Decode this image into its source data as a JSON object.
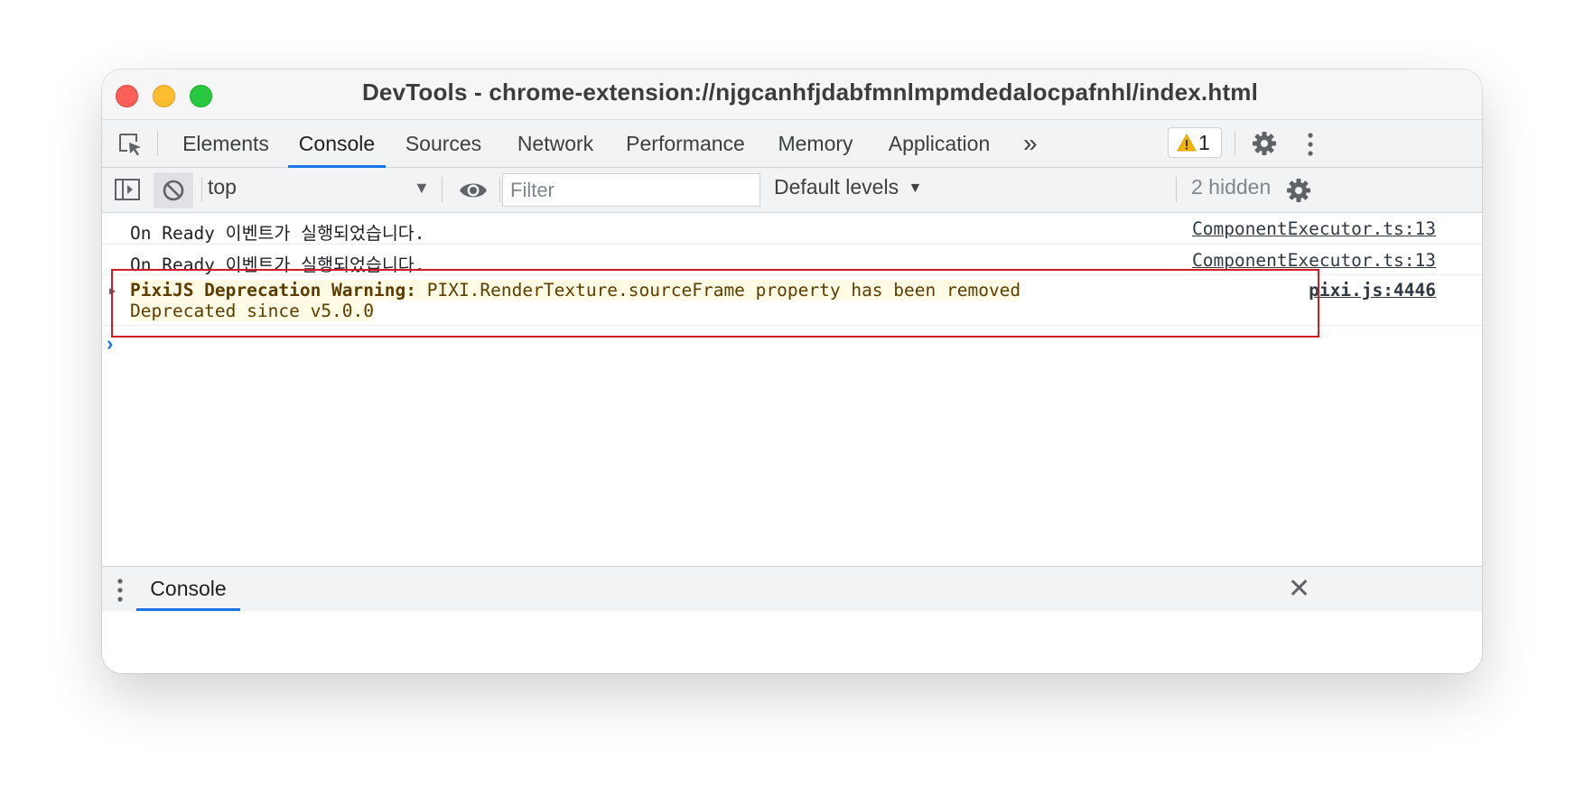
{
  "window": {
    "title": "DevTools - chrome-extension://njgcanhfjdabfmnlmpmdedalocpafnhl/index.html"
  },
  "tabs": [
    {
      "label": "Elements",
      "active": false
    },
    {
      "label": "Console",
      "active": true
    },
    {
      "label": "Sources",
      "active": false
    },
    {
      "label": "Network",
      "active": false
    },
    {
      "label": "Performance",
      "active": false
    },
    {
      "label": "Memory",
      "active": false
    },
    {
      "label": "Application",
      "active": false
    }
  ],
  "more_tabs_icon": "chevron-double-right-icon",
  "warning_badge": {
    "icon": "warning-triangle-icon",
    "count": "1"
  },
  "toolbar": {
    "context": "top",
    "filter_placeholder": "Filter",
    "levels": "Default levels",
    "levels_arrow": "▼",
    "context_arrow": "▼",
    "hidden_count": "2 hidden"
  },
  "console": {
    "messages": [
      {
        "text": "On Ready 이벤트가 실행되었습니다.",
        "source": "ComponentExecutor.ts:13"
      },
      {
        "text": "On Ready 이벤트가 실행되었습니다.",
        "source": "ComponentExecutor.ts:13"
      }
    ],
    "warning": {
      "expander": "▶",
      "label": "PixiJS Deprecation Warning:",
      "message": " PIXI.RenderTexture.sourceFrame property has been removed",
      "detail": "Deprecated since v5.0.0",
      "source": "pixi.js:4446"
    },
    "prompt": "›"
  },
  "drawer": {
    "tab_label": "Console",
    "close_glyph": "✕"
  },
  "colors": {
    "accent": "#1a73e8",
    "warning_bg": "#fffbe5",
    "warning_text": "#5c3c00",
    "highlight_border": "#d01c24"
  }
}
